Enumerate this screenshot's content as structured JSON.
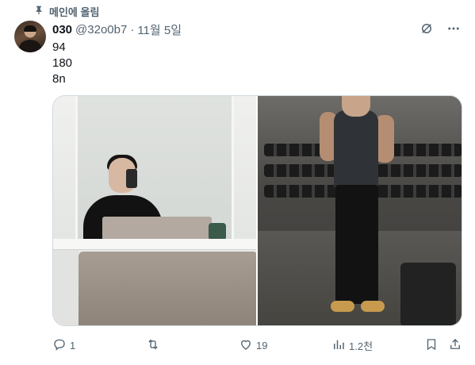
{
  "pinned": {
    "label": "메인에 올림",
    "icon": "pin-icon"
  },
  "author": {
    "name": "030",
    "handle": "@32o0b7",
    "separator": "·",
    "date": "11월 5일",
    "avatar_icon": "avatar"
  },
  "header_icons": [
    "grok-icon",
    "more-icon"
  ],
  "tweet": {
    "lines": [
      "94",
      "180",
      "8n"
    ]
  },
  "media": {
    "count": 2,
    "photos": [
      "mirror-selfie-photo",
      "gym-selfie-photo"
    ]
  },
  "actions": {
    "reply": {
      "icon": "reply-icon",
      "count": "1"
    },
    "repost": {
      "icon": "repost-icon",
      "count": ""
    },
    "like": {
      "icon": "heart-icon",
      "count": "19"
    },
    "views": {
      "icon": "views-icon",
      "count": "1.2천"
    },
    "bookmark": {
      "icon": "bookmark-icon"
    },
    "share": {
      "icon": "share-icon"
    }
  },
  "colors": {
    "text": "#0f1419",
    "secondary": "#536471",
    "border": "#cfd9de"
  }
}
